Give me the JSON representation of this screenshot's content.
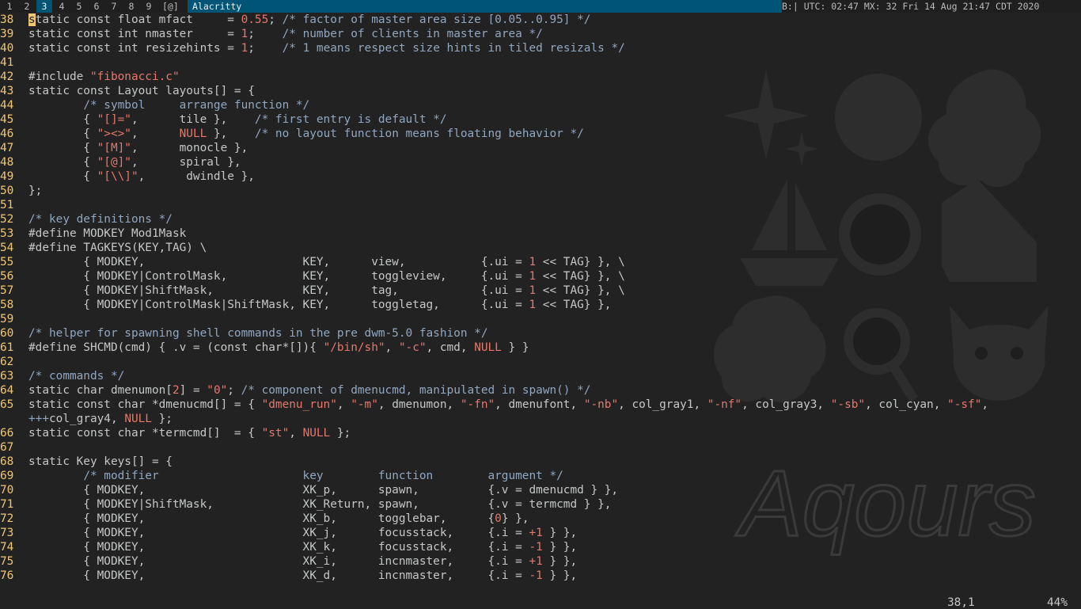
{
  "bar": {
    "tags": [
      {
        "label": "1",
        "sup": "",
        "selected": false
      },
      {
        "label": "2",
        "sup": "",
        "selected": false
      },
      {
        "label": "3",
        "sup": "",
        "selected": true
      },
      {
        "label": "4",
        "sup": "",
        "selected": false
      },
      {
        "label": "5",
        "sup": "",
        "selected": false
      },
      {
        "label": "6",
        "sup": "",
        "selected": false
      },
      {
        "label": "7",
        "sup": "",
        "selected": false
      },
      {
        "label": "8",
        "sup": "",
        "selected": false
      },
      {
        "label": "9",
        "sup": "",
        "selected": false
      }
    ],
    "layout_symbol": "[@]",
    "window_title": "Alacritty",
    "status_text": "B:| UTC: 02:47 MX: 32 Fri 14 Aug 21:47 CDT 2020",
    "colors": {
      "accent": "#005577",
      "bar_bg": "#1f1f1f"
    }
  },
  "editor": {
    "lines": [
      {
        "n": "38",
        "html": "<span class='cursor'>s</span>tatic const float mfact     = <span class='n'>0.55</span>; <span class='c'>/* factor of master area size [0.05..0.95] */</span>"
      },
      {
        "n": "39",
        "html": "static const int nmaster     = <span class='n'>1</span>;    <span class='c'>/* number of clients in master area */</span>"
      },
      {
        "n": "40",
        "html": "static const int resizehints = <span class='n'>1</span>;    <span class='c'>/* 1 means respect size hints in tiled resizals */</span>"
      },
      {
        "n": "41",
        "html": ""
      },
      {
        "n": "42",
        "html": "#include <span class='s'>\"fibonacci.c\"</span>"
      },
      {
        "n": "43",
        "html": "static const Layout layouts[] = {"
      },
      {
        "n": "44",
        "html": "        <span class='c'>/* symbol     arrange function */</span>"
      },
      {
        "n": "45",
        "html": "        { <span class='s'>\"[]=\"</span>,      tile },    <span class='c'>/* first entry is default */</span>"
      },
      {
        "n": "46",
        "html": "        { <span class='s'>\"&gt;&lt;&gt;\"</span>,      <span class='s'>NULL</span> },    <span class='c'>/* no layout function means floating behavior */</span>"
      },
      {
        "n": "47",
        "html": "        { <span class='s'>\"[M]\"</span>,      monocle },"
      },
      {
        "n": "48",
        "html": "        { <span class='s'>\"[@]\"</span>,      spiral },"
      },
      {
        "n": "49",
        "html": "        { <span class='s'>\"[\\\\]\"</span>,      dwindle },"
      },
      {
        "n": "50",
        "html": "};"
      },
      {
        "n": "51",
        "html": ""
      },
      {
        "n": "52",
        "html": "<span class='c'>/* key definitions */</span>"
      },
      {
        "n": "53",
        "html": "#define MODKEY Mod1Mask"
      },
      {
        "n": "54",
        "html": "#define TAGKEYS(KEY,TAG) \\"
      },
      {
        "n": "55",
        "html": "        { MODKEY,                       KEY,      view,           {.ui = <span class='n'>1</span> &lt;&lt; TAG} }, \\"
      },
      {
        "n": "56",
        "html": "        { MODKEY|ControlMask,           KEY,      toggleview,     {.ui = <span class='n'>1</span> &lt;&lt; TAG} }, \\"
      },
      {
        "n": "57",
        "html": "        { MODKEY|ShiftMask,             KEY,      tag,            {.ui = <span class='n'>1</span> &lt;&lt; TAG} }, \\"
      },
      {
        "n": "58",
        "html": "        { MODKEY|ControlMask|ShiftMask, KEY,      toggletag,      {.ui = <span class='n'>1</span> &lt;&lt; TAG} },"
      },
      {
        "n": "59",
        "html": ""
      },
      {
        "n": "60",
        "html": "<span class='c'>/* helper for spawning shell commands in the pre dwm-5.0 fashion */</span>"
      },
      {
        "n": "61",
        "html": "#define SHCMD(cmd) { .v = (const char*[]){ <span class='s'>\"/bin/sh\"</span>, <span class='s'>\"-c\"</span>, cmd, <span class='s'>NULL</span> } }"
      },
      {
        "n": "62",
        "html": ""
      },
      {
        "n": "63",
        "html": "<span class='c'>/* commands */</span>"
      },
      {
        "n": "64",
        "html": "static char dmenumon[<span class='n'>2</span>] = <span class='s'>\"0\"</span>; <span class='c'>/* component of dmenucmd, manipulated in spawn() */</span>"
      },
      {
        "n": "65",
        "html": "static const char *dmenucmd[] = { <span class='s'>\"dmenu_run\"</span>, <span class='s'>\"-m\"</span>, dmenumon, <span class='s'>\"-fn\"</span>, dmenufont, <span class='s'>\"-nb\"</span>, col_gray1, <span class='s'>\"-nf\"</span>, col_gray3, <span class='s'>\"-sb\"</span>, col_cyan, <span class='s'>\"-sf\"</span>,"
      },
      {
        "n": "",
        "html": "<span class='c'>+++</span>col_gray4, <span class='s'>NULL</span> };"
      },
      {
        "n": "66",
        "html": "static const char *termcmd[]  = { <span class='s'>\"st\"</span>, <span class='s'>NULL</span> };"
      },
      {
        "n": "67",
        "html": ""
      },
      {
        "n": "68",
        "html": "static Key keys[] = {"
      },
      {
        "n": "69",
        "html": "        <span class='c'>/* modifier                     key        function        argument */</span>"
      },
      {
        "n": "70",
        "html": "        { MODKEY,                       XK_p,      spawn,          {.v = dmenucmd } },"
      },
      {
        "n": "71",
        "html": "        { MODKEY|ShiftMask,             XK_Return, spawn,          {.v = termcmd } },"
      },
      {
        "n": "72",
        "html": "        { MODKEY,                       XK_b,      togglebar,      {<span class='n'>0</span>} },"
      },
      {
        "n": "73",
        "html": "        { MODKEY,                       XK_j,      focusstack,     {.i = <span class='n'>+1</span> } },"
      },
      {
        "n": "74",
        "html": "        { MODKEY,                       XK_k,      focusstack,     {.i = <span class='n'>-1</span> } },"
      },
      {
        "n": "75",
        "html": "        { MODKEY,                       XK_i,      incnmaster,     {.i = <span class='n'>+1</span> } },"
      },
      {
        "n": "76",
        "html": "        { MODKEY,                       XK_d,      incnmaster,     {.i = <span class='n'>-1</span> } },"
      }
    ],
    "ruler": "38,1",
    "percent": "44%"
  },
  "wallpaper": {
    "logo_text": "Aqours",
    "icon_names": [
      "star-sparkle-icon",
      "dolphin-icon",
      "flower-star-icon",
      "sailboat-icon",
      "orange-slice-icon",
      "piano-icon",
      "swirl-flower-icon",
      "candy-magnifier-icon",
      "devil-face-icon"
    ]
  }
}
